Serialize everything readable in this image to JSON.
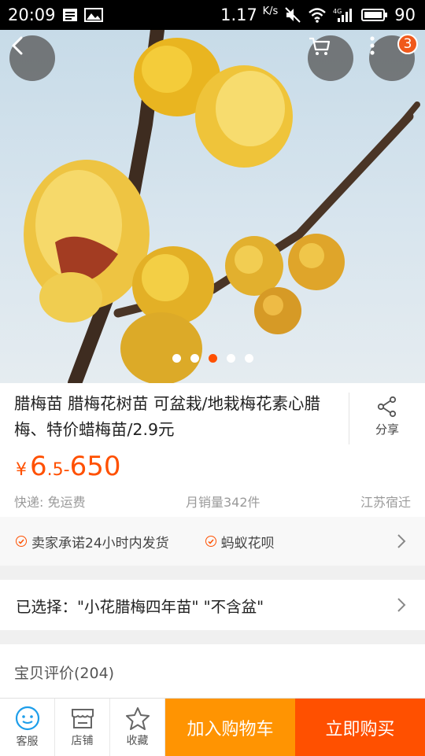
{
  "status_bar": {
    "time": "20:09",
    "speed": "1.17",
    "speed_unit": "K/s",
    "network": "4G",
    "battery": "90"
  },
  "hero": {
    "cart_badge": "3",
    "slide_count": 5,
    "active_slide": 3
  },
  "product": {
    "title": "腊梅苗 腊梅花树苗 可盆栽/地栽梅花素心腊梅、特价蜡梅苗/2.9元",
    "share_label": "分享",
    "price": {
      "symbol": "¥",
      "low_int": "6",
      "low_dec": ".5",
      "sep": "-",
      "high": "650"
    },
    "shipping": "快递: 免运费",
    "monthly_sales": "月销量342件",
    "location": "江苏宿迁"
  },
  "promises": {
    "item1": "卖家承诺24小时内发货",
    "item2": "蚂蚁花呗"
  },
  "selection": {
    "text": "已选择：\"小花腊梅四年苗\" \"不含盆\""
  },
  "reviews": {
    "title": "宝贝评价(204)"
  },
  "bottom_bar": {
    "service": "客服",
    "shop": "店铺",
    "favorite": "收藏",
    "add_to_cart": "加入购物车",
    "buy_now": "立即购买"
  },
  "colors": {
    "accent": "#ff5000",
    "cart_button": "#ff9402"
  }
}
